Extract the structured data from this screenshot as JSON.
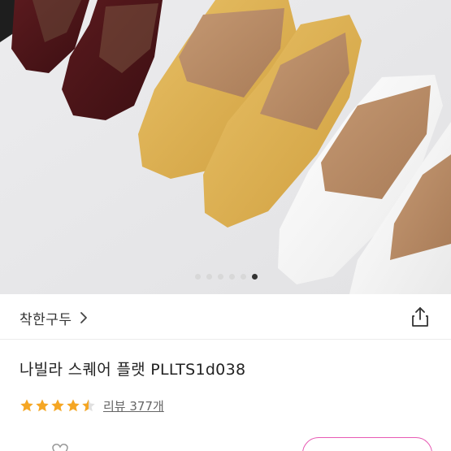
{
  "product_image": {
    "carousel": {
      "total": 6,
      "active_index": 5
    }
  },
  "seller": {
    "name": "착한구두",
    "chevron_icon": "chevron-right-icon",
    "share_icon": "share-icon"
  },
  "product": {
    "title": "나빌라 스퀘어 플랫 PLLTS1d038",
    "rating": 4.5,
    "rating_max": 5,
    "review_label": "리뷰 377개"
  },
  "colors": {
    "star": "#f5a623",
    "accent": "#e75ab4",
    "text_primary": "#222222",
    "text_secondary": "#666666"
  }
}
